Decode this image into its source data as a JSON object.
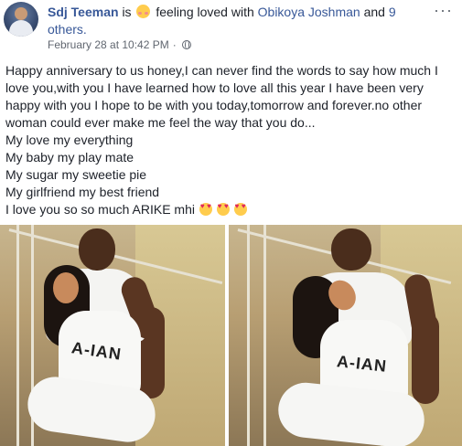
{
  "post": {
    "author": "Sdj Teeman",
    "is_text": "is",
    "feeling_text": "feeling loved with",
    "tagged_person": "Obikoya Joshman",
    "and_text": "and",
    "others_link": "9 others.",
    "timestamp": "February 28 at 10:42 PM",
    "separator": "·",
    "privacy_icon": "globe-icon",
    "more_icon": "more-options-icon",
    "body_paragraph": "Happy anniversary to us honey,I can never find the words to say how much I love you,with you I have learned how to love all this year I have been very happy with you I hope to be with you today,tomorrow and forever.no other woman could ever make me feel the way that you do...",
    "body_lines": [
      "My love my everything",
      "My baby my play mate",
      "My sugar my sweetie pie",
      "My girlfriend my best friend"
    ],
    "last_line": "I love you so so much ARIKE mhi",
    "emoji_count": 3
  },
  "colors": {
    "link": "#385898",
    "text": "#1d2129",
    "meta": "#616770",
    "emoji": "#ffcc4d"
  },
  "photos": [
    {
      "name": "couple-photo-left",
      "shirt_text": "A-IAN"
    },
    {
      "name": "couple-photo-right",
      "shirt_text": "A-IAN"
    }
  ]
}
